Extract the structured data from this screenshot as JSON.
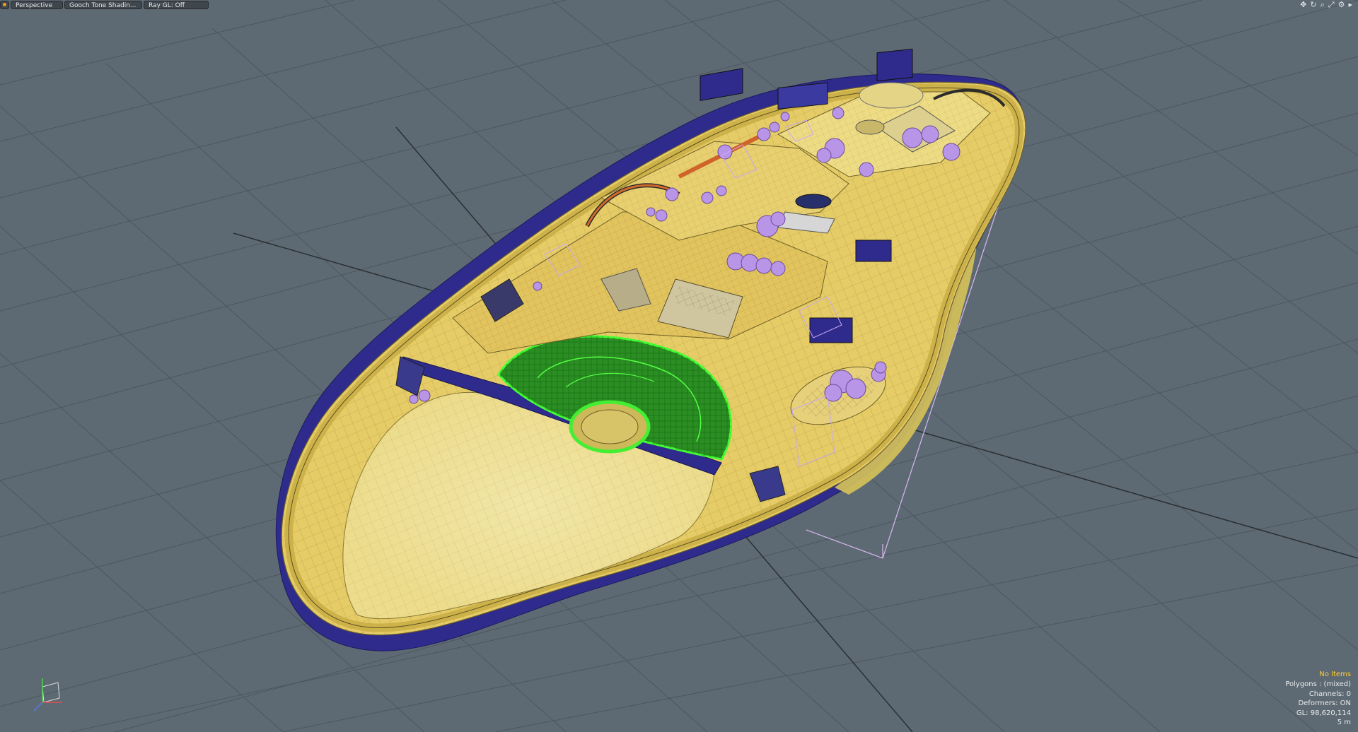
{
  "toolbar": {
    "perspective_label": "Perspective",
    "shading_label": "Gooch Tone Shadin...",
    "raygl_label": "Ray GL: Off",
    "menu_icon": "viewport-menu-icon"
  },
  "nav_icons": [
    "move-view-icon",
    "rotate-view-icon",
    "zoom-view-icon",
    "fit-view-icon",
    "settings-gear-icon",
    "expand-arrow-icon"
  ],
  "info": {
    "selection": "No Items",
    "polygons": "Polygons : (mixed)",
    "channels": "Channels: 0",
    "deformers": "Deformers: ON",
    "gl": "GL: 98,620,114",
    "scale": "5 m"
  },
  "colors": {
    "background": "#5e6a73",
    "grid": "#4b565e",
    "mesh_fill": "#e8cf6a",
    "mesh_wire": "#6d5f28",
    "side_wall": "#2d2a8a",
    "selected_green": "#33dd22",
    "tree_purple": "#b995e8",
    "hud_highlight": "#ffcc33"
  }
}
